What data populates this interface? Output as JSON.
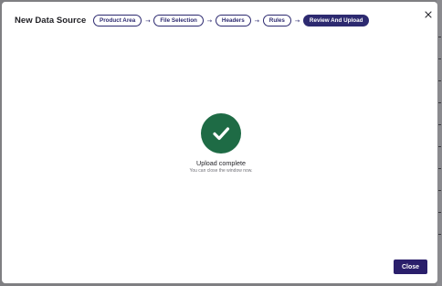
{
  "modal": {
    "title": "New Data Source",
    "close_icon": "close-icon"
  },
  "stepper": {
    "steps": [
      {
        "label": "Product Area",
        "active": false
      },
      {
        "label": "File Selection",
        "active": false
      },
      {
        "label": "Headers",
        "active": false
      },
      {
        "label": "Rules",
        "active": false
      },
      {
        "label": "Review And Upload",
        "active": true
      }
    ],
    "separator_icon": "arrow-right-icon"
  },
  "status": {
    "icon": "check-circle-icon",
    "title": "Upload complete",
    "subtitle": "You can close the window now."
  },
  "footer": {
    "close_label": "Close"
  },
  "colors": {
    "primary": "#2d2a70",
    "success": "#1e6b45",
    "backdrop": "#7f7f82"
  }
}
